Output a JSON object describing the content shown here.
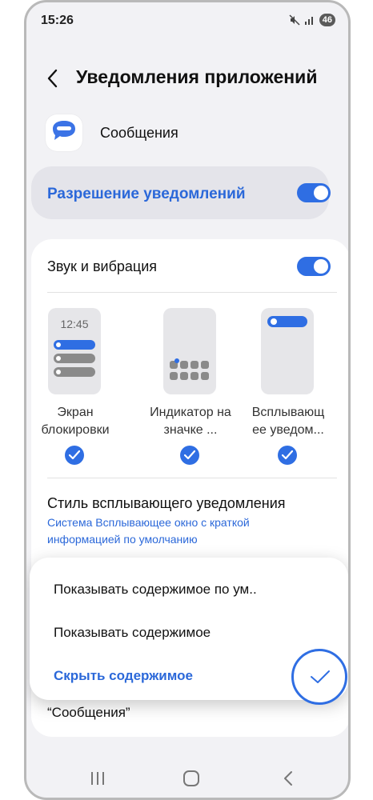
{
  "status_bar": {
    "time": "15:26",
    "battery": "46"
  },
  "header": {
    "back_icon": "chevron-left",
    "title": "Уведомления приложений"
  },
  "app": {
    "name": "Сообщения",
    "icon": "messages-bubble",
    "icon_color": "#3b73e6"
  },
  "allow_notifications": {
    "label": "Разрешение уведомлений",
    "enabled": true
  },
  "sound_vibration": {
    "label": "Звук и вибрация",
    "enabled": true
  },
  "notification_types": [
    {
      "label": "Экран блокировки",
      "preview_time": "12:45",
      "checked": true
    },
    {
      "label": "Индикатор на значке ...",
      "checked": true
    },
    {
      "label": "Всплывающ ее уведом...",
      "checked": true
    }
  ],
  "popup_style": {
    "title": "Стиль всплывающего уведомления",
    "subtitle": "Система Всплывающее окно с краткой информацией по умолчанию"
  },
  "dropdown": {
    "options": [
      {
        "label": "Показывать содержимое по ум..",
        "selected": false
      },
      {
        "label": "Показывать содержимое",
        "selected": false
      },
      {
        "label": "Скрыть содержимое",
        "selected": true
      }
    ]
  },
  "behind_text": "“Сообщения”",
  "colors": {
    "accent": "#2f6ee3",
    "accent_text": "#2b68d9",
    "background": "#f2f2f5"
  }
}
